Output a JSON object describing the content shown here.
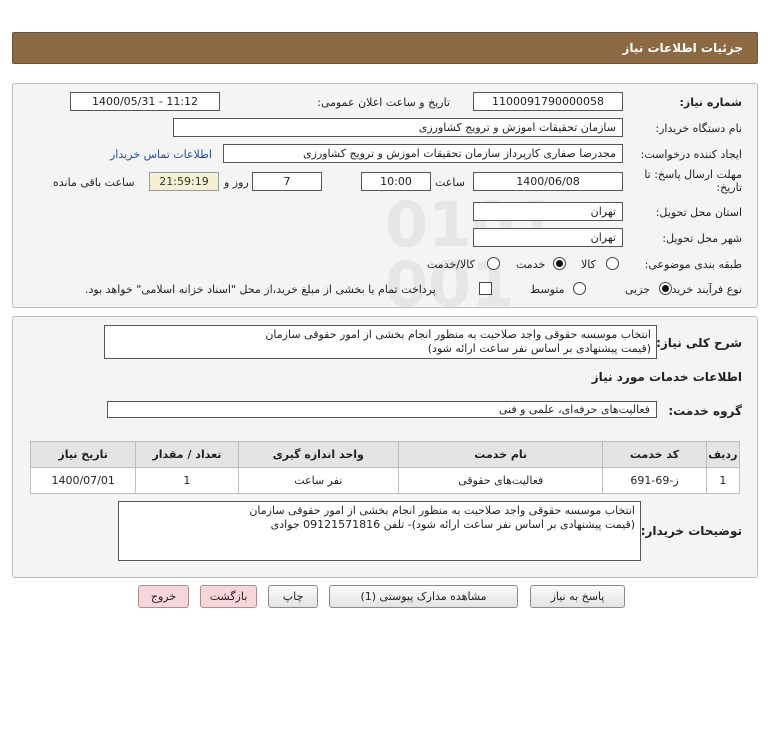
{
  "header": {
    "title": "جزئیات اطلاعات نیاز"
  },
  "form": {
    "need_number": {
      "label": "شماره نیاز:",
      "value": "1100091790000058"
    },
    "announce": {
      "label": "تاریخ و ساعت اعلان عمومی:",
      "value": "1400/05/31 - 11:12"
    },
    "buyer_org": {
      "label": "نام دستگاه خریدار:",
      "value": "سازمان تحقیقات  اموزش و ترویج کشاورزی"
    },
    "requester": {
      "label": "ایجاد کننده درخواست:",
      "value": "مجدرضا صفاری کارپرداز سازمان تحقیقات  اموزش و ترویج کشاورزی",
      "contact_link": "اطلاعات تماس خریدار"
    },
    "deadline": {
      "label_line1": "مهلت ارسال پاسخ: تا",
      "label_line2": "تاریخ:",
      "date": "1400/06/08",
      "time_label": "ساعت",
      "time": "10:00",
      "days": "7",
      "days_label": "روز و",
      "remaining": "21:59:19",
      "remaining_label": "ساعت باقی مانده"
    },
    "province": {
      "label": "استان محل تحویل:",
      "value": "تهران"
    },
    "city": {
      "label": "شهر محل تحویل:",
      "value": "تهران"
    },
    "category": {
      "label": "طبقه بندی موضوعی:",
      "options": [
        "کالا",
        "خدمت",
        "کالا/خدمت"
      ],
      "selected": "خدمت"
    },
    "purchase_type": {
      "label": "نوع فرآیند خرید :",
      "options": [
        "جزیی",
        "متوسط"
      ],
      "selected": "جزیی",
      "payment_note": "پرداخت تمام یا بخشی از مبلغ خرید،از محل \"اسناد خزانه اسلامی\" خواهد بود."
    }
  },
  "summary": {
    "label": "شرح کلی نیاز:",
    "text": "انتخاب موسسه حقوقی واجد صلاحیت به منظور انجام بخشی از امور حقوقی سازمان\n(قیمت پیشنهادی بر اساس نفر ساعت ارائه شود)"
  },
  "services": {
    "section_title": "اطلاعات خدمات مورد نیاز",
    "group_label": "گروه خدمت:",
    "group_value": "فعالیت‌های حرفه‌ای، علمی و فنی",
    "table": {
      "headers": [
        "ردیف",
        "کد خدمت",
        "نام خدمت",
        "واحد اندازه گیری",
        "تعداد / مقدار",
        "تاریخ نیاز"
      ],
      "rows": [
        [
          "1",
          "ز-69-691",
          "فعالیت‌های حقوقی",
          "نفر ساعت",
          "1",
          "1400/07/01"
        ]
      ]
    }
  },
  "buyer_notes": {
    "label": "توضیحات خریدار:",
    "text": "انتخاب موسسه حقوقی واجد صلاحیت به منظور انجام بخشی از امور حقوقی سازمان\n(قیمت پیشنهادی بر اساس نفر ساعت ارائه شود)- تلفن 09121571816 جوادی"
  },
  "buttons": {
    "reply": "پاسخ به نیاز",
    "attachments": "مشاهده مدارک پیوستی (1)",
    "print": "چاپ",
    "back": "بازگشت",
    "exit": "خروج"
  },
  "watermark": {
    "line1": "ParsNamadData",
    "line2": "مرکز فرآیند اطلاعات پارس نماد داده",
    "line3": "پایگاه اطلاع رسانی مناقصه و مزایده"
  },
  "colors": {
    "header": "#8b6a43",
    "panel": "#f4f4f4",
    "link": "#1d4fa8",
    "remaining_bg": "#f3f1cf",
    "exit_bg": "#f6d6d9"
  }
}
